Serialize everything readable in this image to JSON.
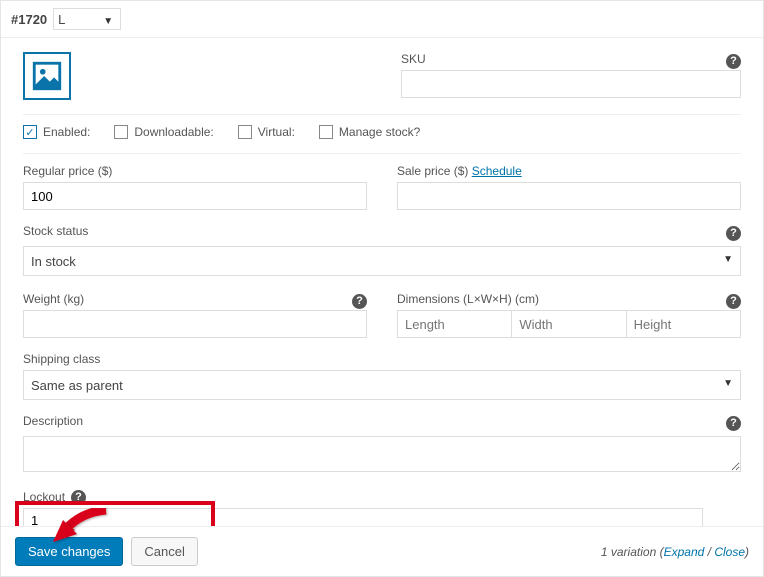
{
  "variation_id": "#1720",
  "variation_select": "L",
  "sku": {
    "label": "SKU",
    "value": ""
  },
  "checkboxes": {
    "enabled": {
      "label": "Enabled:",
      "checked": true
    },
    "downloadable": {
      "label": "Downloadable:",
      "checked": false
    },
    "virtual": {
      "label": "Virtual:",
      "checked": false
    },
    "manage_stock": {
      "label": "Manage stock?",
      "checked": false
    }
  },
  "regular_price": {
    "label": "Regular price ($)",
    "value": "100"
  },
  "sale_price": {
    "label": "Sale price ($)",
    "schedule": "Schedule",
    "value": ""
  },
  "stock_status": {
    "label": "Stock status",
    "value": "In stock"
  },
  "weight": {
    "label": "Weight (kg)",
    "value": ""
  },
  "dimensions": {
    "label": "Dimensions (L×W×H) (cm)",
    "length_ph": "Length",
    "width_ph": "Width",
    "height_ph": "Height"
  },
  "shipping_class": {
    "label": "Shipping class",
    "value": "Same as parent"
  },
  "description": {
    "label": "Description",
    "value": ""
  },
  "lockout": {
    "label": "Lockout",
    "value": "1"
  },
  "buttons": {
    "save": "Save changes",
    "cancel": "Cancel"
  },
  "footer": {
    "count": "1 variation",
    "expand": "Expand",
    "close": "Close",
    "sep": " / "
  }
}
